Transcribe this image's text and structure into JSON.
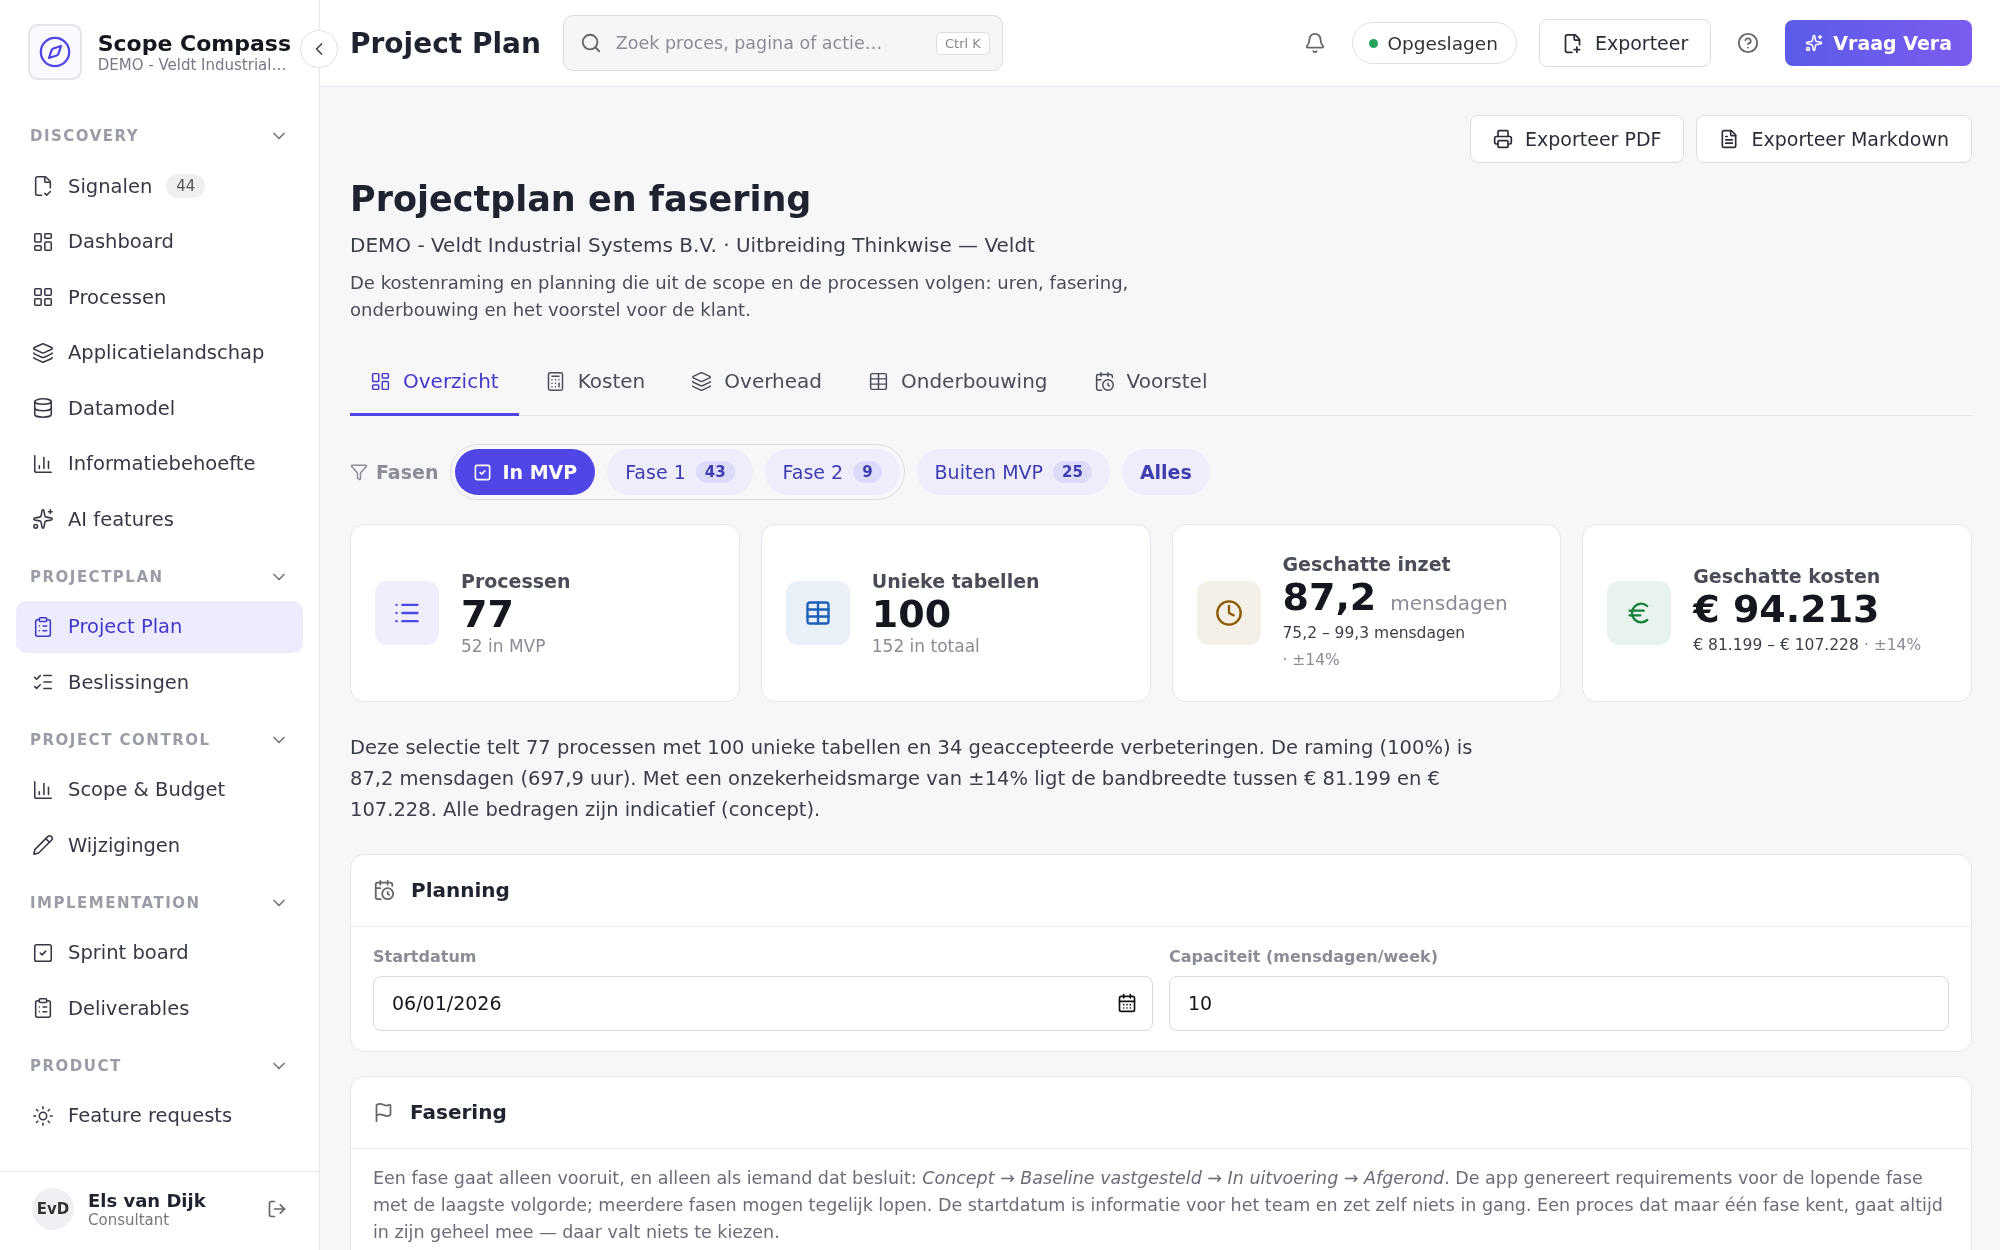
{
  "app": {
    "name": "Scope Compass",
    "workspace": "DEMO - Veldt Industrial…"
  },
  "sidebar": {
    "sections": [
      {
        "title": "DISCOVERY",
        "expanded": true,
        "items": [
          {
            "label": "Signalen",
            "badge": "44",
            "selected": false
          },
          {
            "label": "Dashboard",
            "selected": false
          },
          {
            "label": "Processen",
            "selected": false
          },
          {
            "label": "Applicatielandschap",
            "selected": false
          },
          {
            "label": "Datamodel",
            "selected": false
          },
          {
            "label": "Informatiebehoefte",
            "selected": false
          },
          {
            "label": "AI features",
            "selected": false
          }
        ]
      },
      {
        "title": "PROJECTPLAN",
        "expanded": true,
        "items": [
          {
            "label": "Project Plan",
            "selected": true
          },
          {
            "label": "Beslissingen",
            "selected": false
          }
        ]
      },
      {
        "title": "PROJECT CONTROL",
        "expanded": true,
        "items": [
          {
            "label": "Scope & Budget",
            "selected": false
          },
          {
            "label": "Wijzigingen",
            "selected": false
          }
        ]
      },
      {
        "title": "IMPLEMENTATION",
        "expanded": true,
        "items": [
          {
            "label": "Sprint board",
            "selected": false
          },
          {
            "label": "Deliverables",
            "selected": false
          }
        ]
      },
      {
        "title": "PRODUCT",
        "expanded": true,
        "items": [
          {
            "label": "Feature requests",
            "selected": false
          }
        ]
      }
    ]
  },
  "user": {
    "initials": "EvD",
    "name": "Els van Dijk",
    "role": "Consultant"
  },
  "header": {
    "title": "Project Plan",
    "search": {
      "placeholder": "Zoek proces, pagina of actie…",
      "shortcut": "Ctrl K"
    },
    "status": "Opgeslagen",
    "export": "Exporteer",
    "assistant": "Vraag Vera"
  },
  "page_actions": [
    "Exporteer PDF",
    "Exporteer Markdown"
  ],
  "page": {
    "title": "Projectplan en fasering",
    "subtitle": "DEMO - Veldt Industrial Systems B.V. · Uitbreiding Thinkwise — Veldt",
    "description": "De kostenraming en planning die uit de scope en de processen volgen: uren, fasering, onderbouwing en het voorstel voor de klant."
  },
  "tabs": [
    {
      "label": "Overzicht",
      "selected": true
    },
    {
      "label": "Kosten",
      "selected": false
    },
    {
      "label": "Overhead",
      "selected": false
    },
    {
      "label": "Onderbouwing",
      "selected": false
    },
    {
      "label": "Voorstel",
      "selected": false
    }
  ],
  "filters": {
    "label": "Fasen",
    "groups": [
      {
        "outlined": true,
        "chips": [
          {
            "label": "In MVP",
            "kind": "phase",
            "selected": true
          },
          {
            "label": "Fase 1",
            "count": "43",
            "kind": "phase",
            "selected": false
          },
          {
            "label": "Fase 2",
            "count": "9",
            "kind": "phase",
            "selected": false
          }
        ]
      },
      {
        "outlined": false,
        "chips": [
          {
            "label": "Buiten MVP",
            "count": "25",
            "kind": "phase",
            "selected": false
          },
          {
            "label": "Alles",
            "kind": "all",
            "selected": false
          }
        ]
      }
    ]
  },
  "stats": [
    {
      "label": "Processen",
      "value": "77",
      "detail": "52 in MVP",
      "color": "#4f46e5"
    },
    {
      "label": "Unieke tabellen",
      "value": "100",
      "detail": "152 in totaal",
      "color": "#1d5fb8"
    },
    {
      "label": "Geschatte inzet",
      "value": "87,2",
      "unit": "mensdagen",
      "range": "75,2 – 99,3 mensdagen",
      "margin": "· ±14%",
      "color": "#8a5a00"
    },
    {
      "label": "Geschatte kosten",
      "value": "€ 94.213",
      "range": "€ 81.199 – € 107.228",
      "margin": "· ±14%",
      "color": "#15803d"
    }
  ],
  "summary": "Deze selectie telt 77 processen met 100 unieke tabellen en 34 geaccepteerde verbeteringen. De raming (100%) is 87,2 mensdagen (697,9 uur). Met een onzekerheidsmarge van ±14% ligt de bandbreedte tussen € 81.199 en € 107.228. Alle bedragen zijn indicatief (concept).",
  "planning": {
    "title": "Planning",
    "fields": [
      {
        "label": "Startdatum",
        "value": "06/01/2026",
        "kind": "date"
      },
      {
        "label": "Capaciteit (mensdagen/week)",
        "value": "10",
        "kind": "number"
      }
    ]
  },
  "phasing": {
    "title": "Fasering",
    "text": "Een fase gaat alleen vooruit, en alleen als iemand dat besluit: *Concept → Baseline vastgesteld → In uitvoering → Afgerond*. De app genereert requirements voor de lopende fase met de laagste volgorde; meerdere fasen mogen tegelijk lopen. De startdatum is informatie voor het team en zet zelf niets in gang. Een proces dat maar één fase kent, gaat altijd in zijn geheel mee — daar valt niets te kiezen."
  }
}
